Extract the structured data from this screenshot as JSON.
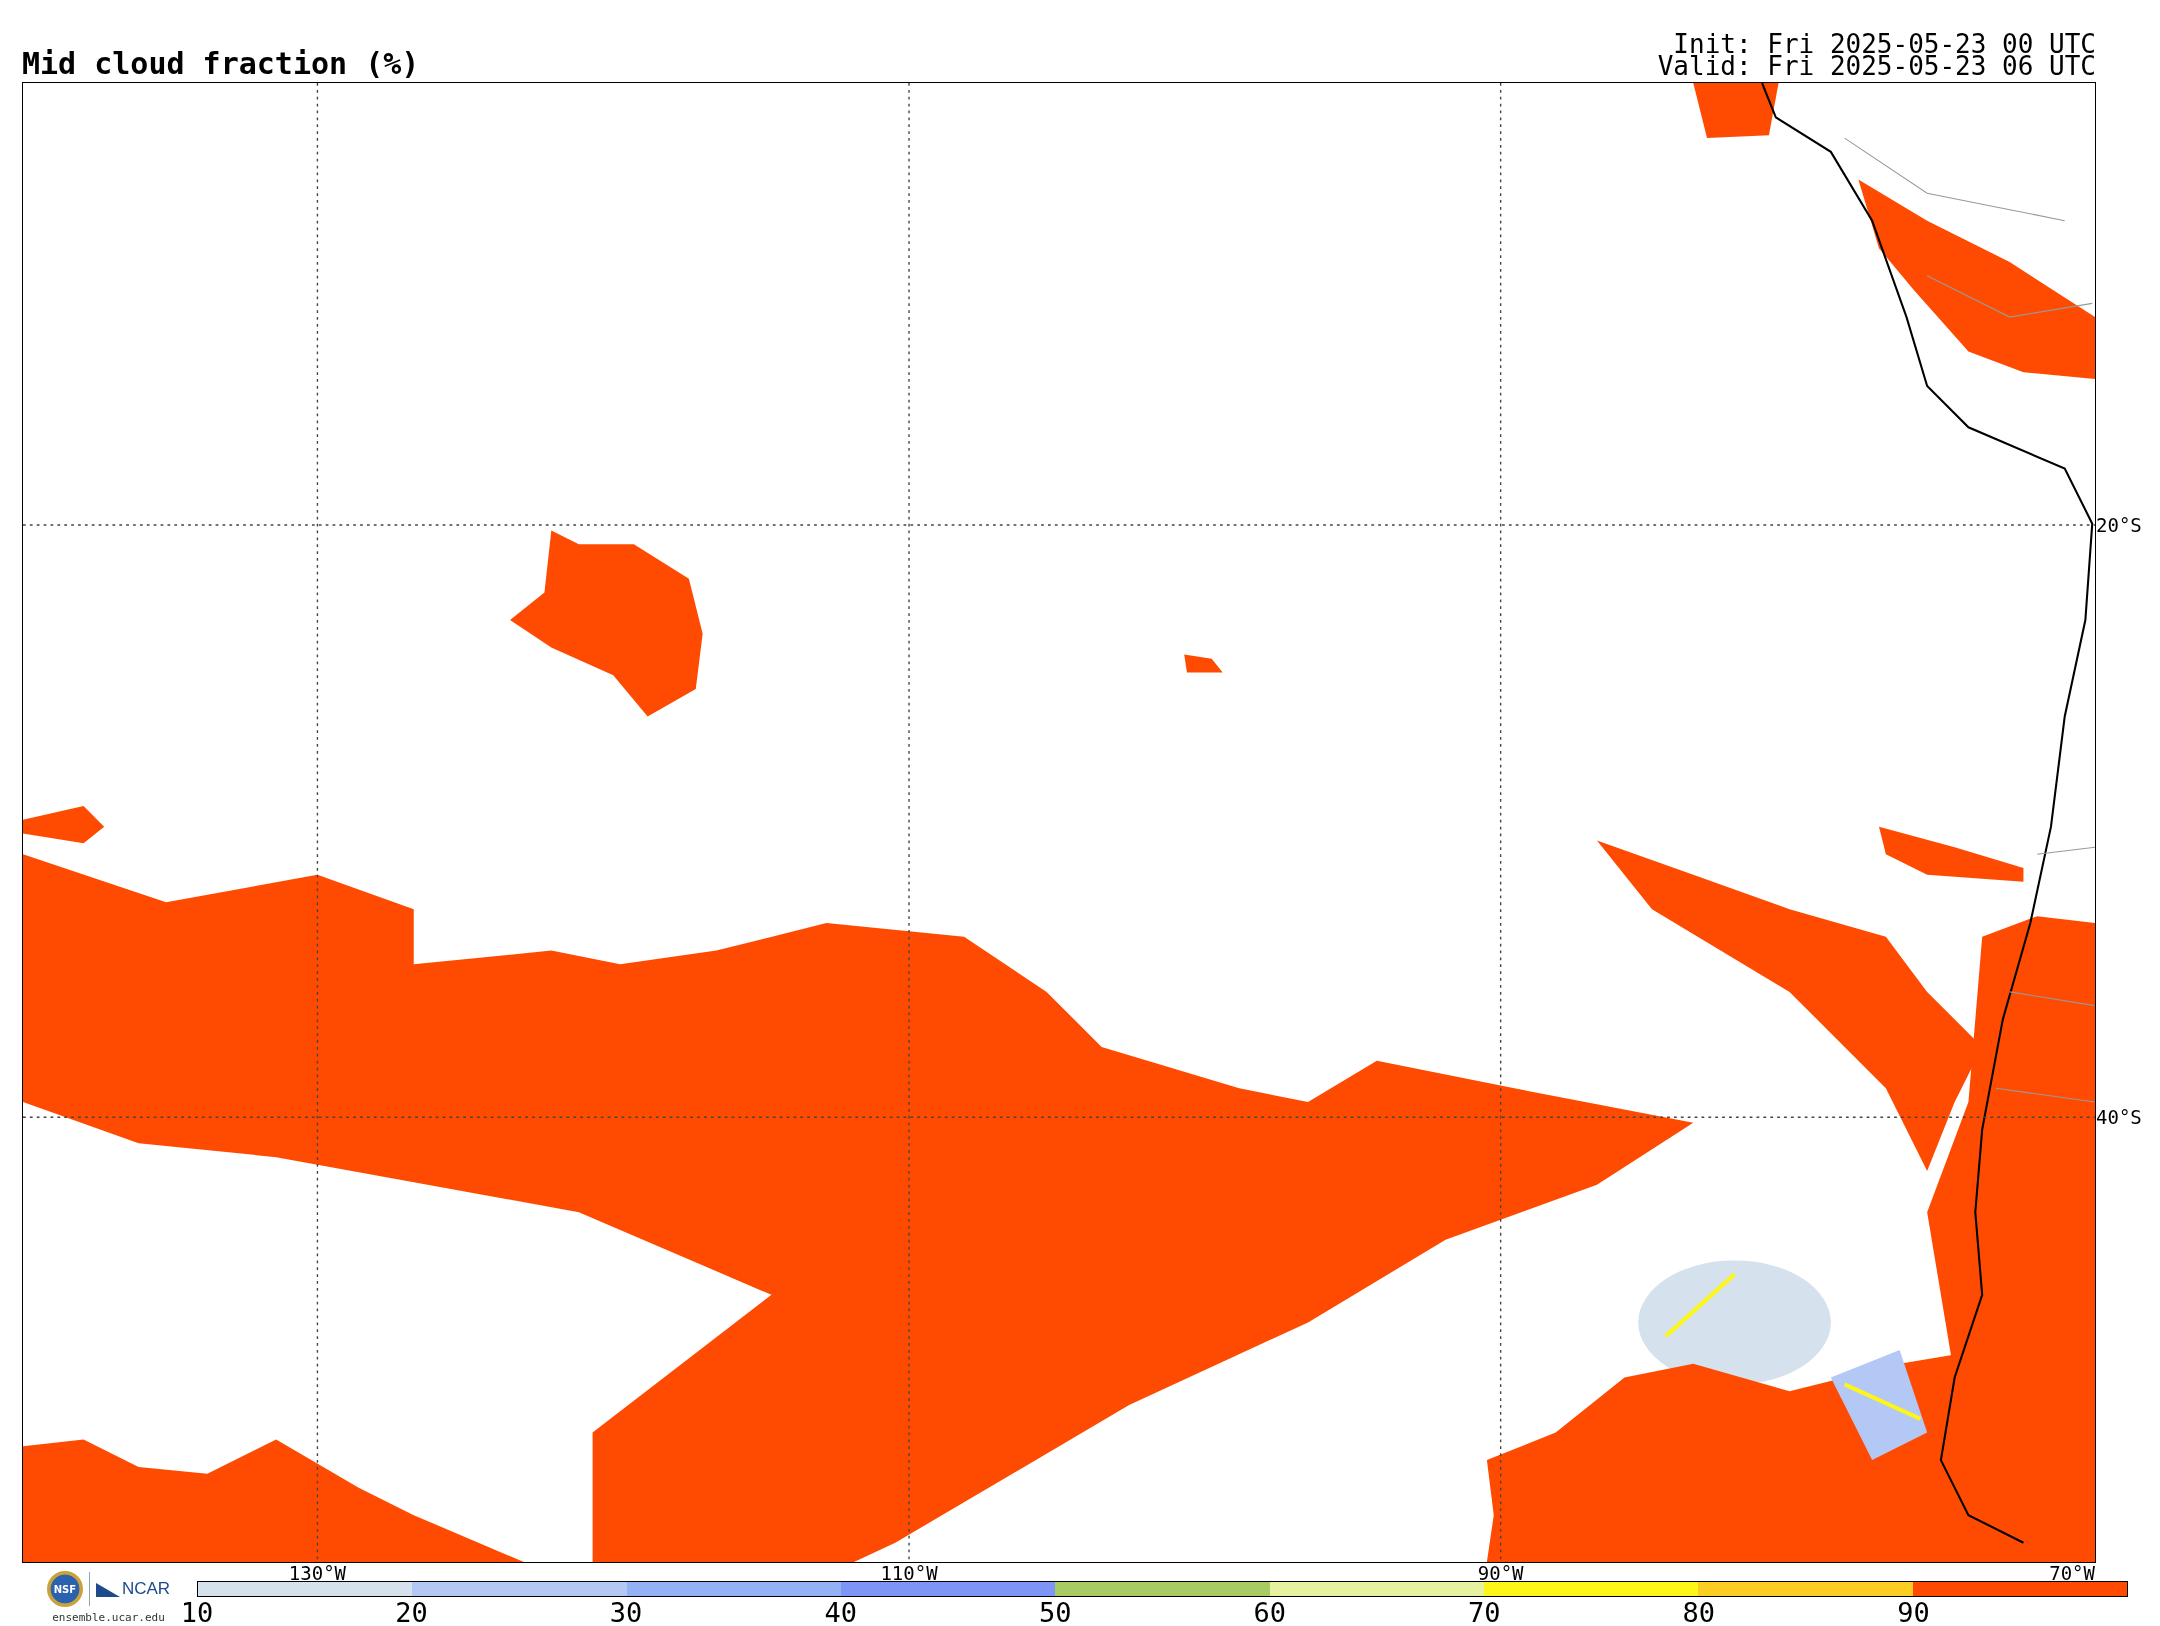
{
  "title": "Mid cloud fraction (%)",
  "run_info": {
    "init": "Init: Fri 2025-05-23 00 UTC",
    "valid": "Valid: Fri 2025-05-23 06 UTC"
  },
  "map": {
    "longitude_labels": [
      "130°W",
      "110°W",
      "90°W",
      "70°W"
    ],
    "latitude_labels": [
      "20°S",
      "40°S"
    ]
  },
  "logo": {
    "seal": "NSF",
    "name": "NCAR",
    "url": "ensemble.ucar.edu"
  },
  "colorbar": {
    "segments": [
      {
        "color": "#d5e1ec"
      },
      {
        "color": "#b4c8f6"
      },
      {
        "color": "#93b2f6"
      },
      {
        "color": "#7d96f6"
      },
      {
        "color": "#a8cc62"
      },
      {
        "color": "#e6f2a0"
      },
      {
        "color": "#fdf618"
      },
      {
        "color": "#fccd22"
      },
      {
        "color": "#fe4b01"
      }
    ],
    "ticks": [
      "10",
      "20",
      "30",
      "40",
      "50",
      "60",
      "70",
      "80",
      "90"
    ]
  }
}
